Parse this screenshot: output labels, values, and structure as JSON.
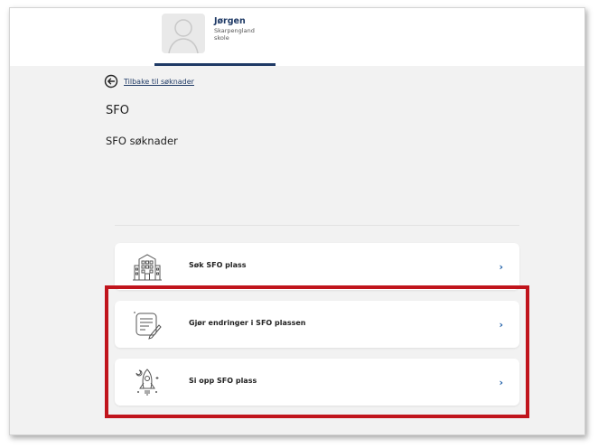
{
  "header": {
    "user_name": "Jørgen",
    "school_line1": "Skarpengland",
    "school_line2": "skole"
  },
  "nav": {
    "back_label": "Tilbake til søknader"
  },
  "page": {
    "title": "SFO",
    "subtitle": "SFO søknader"
  },
  "options": [
    {
      "label": "Søk SFO plass",
      "icon": "school-building-icon"
    },
    {
      "label": "Gjør endringer i SFO plassen",
      "icon": "edit-document-icon"
    },
    {
      "label": "Si opp SFO plass",
      "icon": "rocket-icon"
    }
  ],
  "chevron": "›",
  "colors": {
    "brand_navy": "#1f3a66",
    "chevron_blue": "#1f5fa8",
    "highlight_red": "#c0141c",
    "page_bg": "#f2f2f2"
  }
}
